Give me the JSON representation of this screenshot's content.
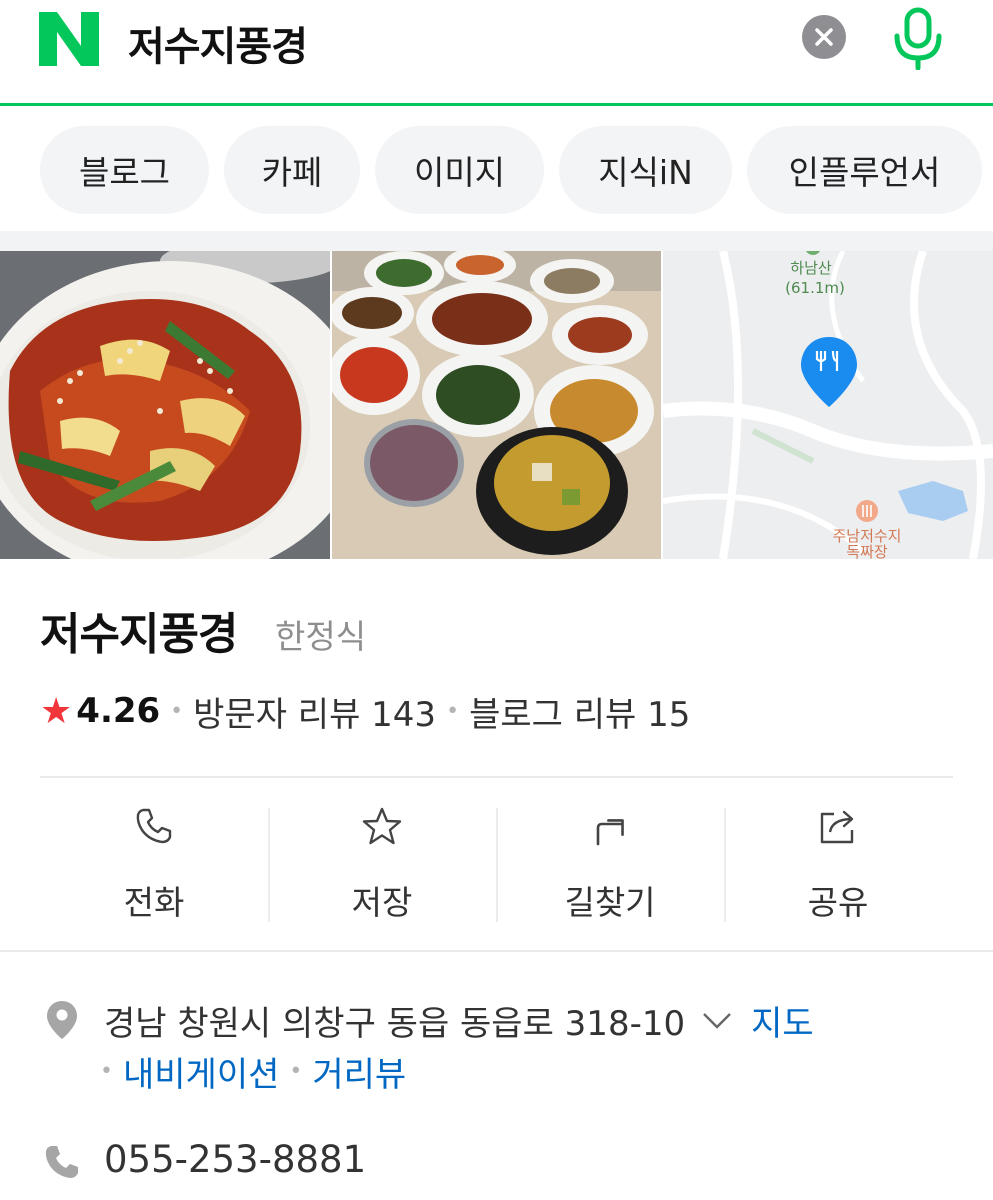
{
  "search": {
    "query": "저수지풍경",
    "logo_icon": "naver-n-logo",
    "clear_icon": "close-icon",
    "mic_icon": "microphone-icon",
    "accent": "#03c75a"
  },
  "tabs": [
    {
      "label": "블로그"
    },
    {
      "label": "카페"
    },
    {
      "label": "이미지"
    },
    {
      "label": "지식iN"
    },
    {
      "label": "인플루언서"
    }
  ],
  "photos": [
    {
      "description_icon": "food-photo"
    },
    {
      "description_icon": "table-dishes-photo"
    },
    {
      "description_icon": "map-thumbnail"
    }
  ],
  "map": {
    "mountain_name": "하남산",
    "mountain_height": "(61.1m)",
    "poi_name": "주남저수지",
    "poi_sub": "독짜장"
  },
  "place": {
    "name": "저수지풍경",
    "category": "한정식",
    "rating": "4.26",
    "visitor_reviews": "방문자 리뷰 143",
    "blog_reviews": "블로그 리뷰 15",
    "star_color": "#f0363a"
  },
  "actions": [
    {
      "label": "전화",
      "icon": "phone-icon"
    },
    {
      "label": "저장",
      "icon": "star-icon"
    },
    {
      "label": "길찾기",
      "icon": "directions-icon"
    },
    {
      "label": "공유",
      "icon": "share-icon"
    }
  ],
  "address": {
    "text": "경남 창원시 의창구 동읍 동읍로 318-10",
    "map_link": "지도",
    "navigation_link": "내비게이션",
    "street_view_link": "거리뷰",
    "link_color": "#0068c3"
  },
  "phone": {
    "number": "055-253-8881"
  }
}
